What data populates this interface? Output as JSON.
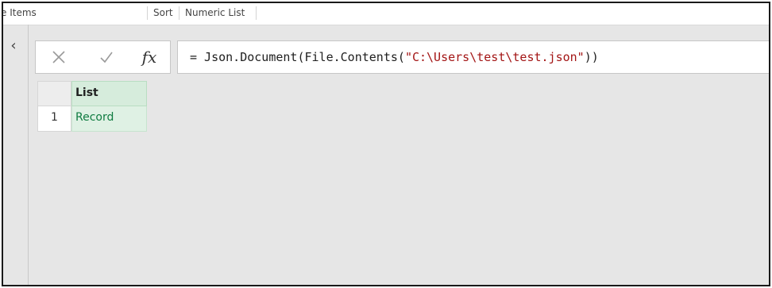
{
  "ribbon": {
    "items_label": "e Items",
    "sort_label": "Sort",
    "numeric_list_label": "Numeric List"
  },
  "sidebar": {
    "collapse_glyph": "‹"
  },
  "formula": {
    "cancel_glyph": "✕",
    "confirm_glyph": "✓",
    "fx_label": "fx",
    "prefix": "= Json.Document(File.Contents(",
    "path_string": "\"C:\\Users\\test\\test.json\"",
    "suffix": "))"
  },
  "table": {
    "column_header": "List",
    "rows": [
      {
        "index": "1",
        "value": "Record"
      }
    ]
  }
}
